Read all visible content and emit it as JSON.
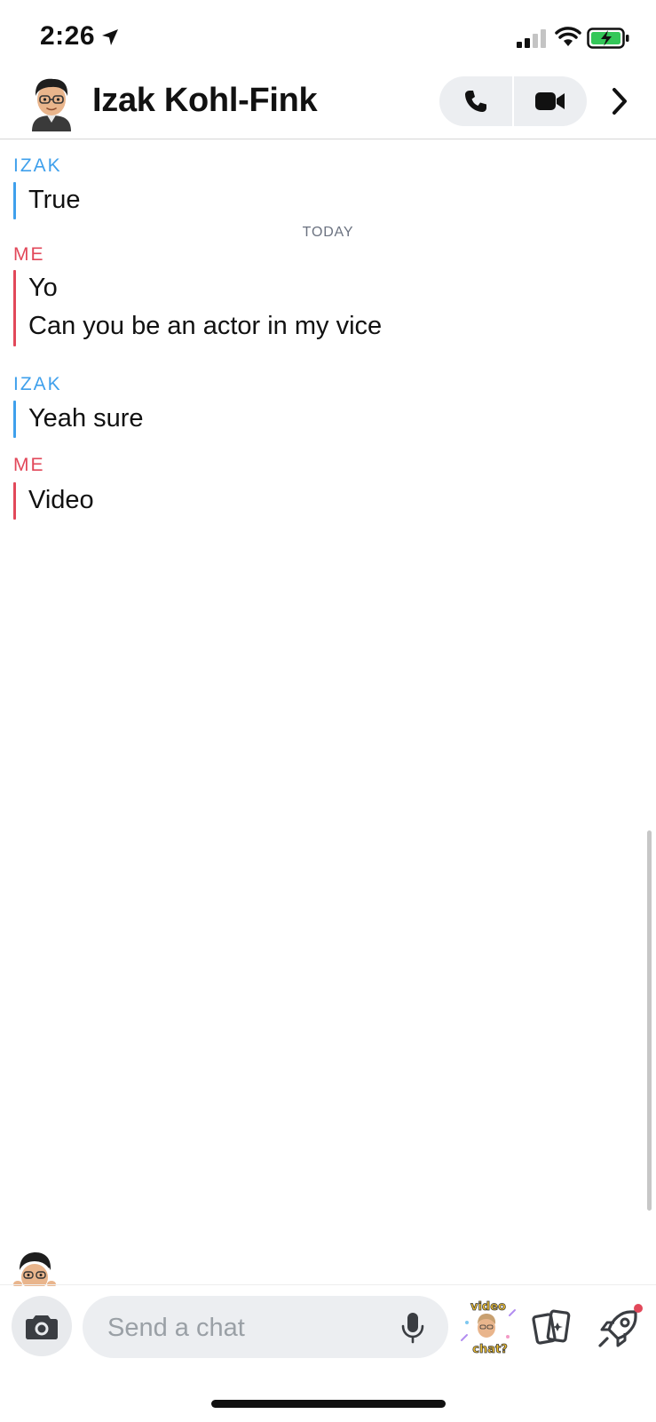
{
  "status_bar": {
    "time": "2:26"
  },
  "header": {
    "contact_name": "Izak Kohl-Fink",
    "icons": [
      "avatar-bitmoji",
      "phone-icon",
      "video-camera-icon",
      "chevron-right-icon"
    ]
  },
  "messages": [
    {
      "sender": "IZAK",
      "lines": [
        "True"
      ]
    },
    {
      "separator": "TODAY"
    },
    {
      "sender": "ME",
      "lines": [
        "Yo",
        "Can you be an actor in my vice"
      ]
    },
    {
      "sender": "IZAK",
      "lines": [
        "Yeah sure"
      ]
    },
    {
      "sender": "ME",
      "lines": [
        "Video"
      ]
    }
  ],
  "labels": {
    "izak": "IZAK",
    "me": "ME",
    "today": "TODAY",
    "msg_true": "True",
    "msg_yo": "Yo",
    "msg_actor": "Can you be an actor in my vice",
    "msg_yeah": "Yeah sure",
    "msg_video": "Video"
  },
  "composer": {
    "placeholder": "Send a chat",
    "sticker_text_top": "video",
    "sticker_text_bottom": "chat?"
  },
  "colors": {
    "friend_accent": "#3fa0ec",
    "me_accent": "#e2485a",
    "notification_dot": "#e2485a"
  }
}
